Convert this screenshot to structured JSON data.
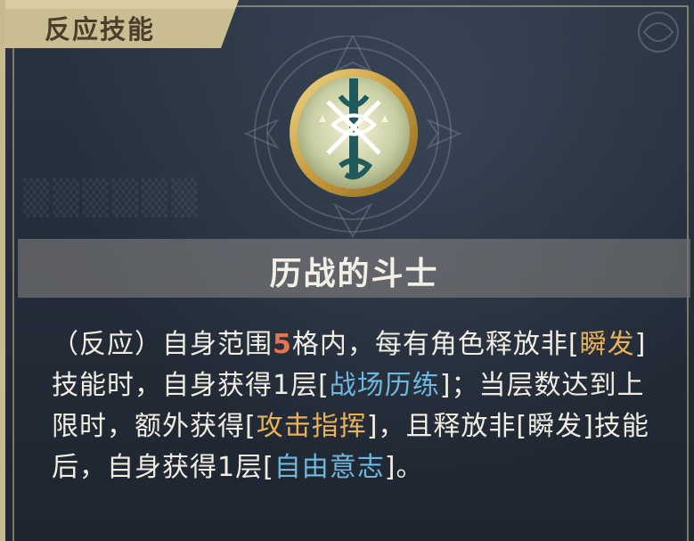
{
  "header": {
    "title": "反应技能"
  },
  "skill": {
    "name": "历战的斗士",
    "description": [
      {
        "t": "（反应）自身范围",
        "s": "plain"
      },
      {
        "t": "5",
        "s": "num"
      },
      {
        "t": "格内，每有角色释放非[",
        "s": "plain"
      },
      {
        "t": "瞬发",
        "s": "gold"
      },
      {
        "t": "]技能时，自身获得1层[",
        "s": "plain"
      },
      {
        "t": "战场历练",
        "s": "blue"
      },
      {
        "t": "]；当层数达到上限时，额外获得[",
        "s": "plain"
      },
      {
        "t": "攻击指挥",
        "s": "gold"
      },
      {
        "t": "]，且释放非[瞬发]技能后，自身获得1层[",
        "s": "plain"
      },
      {
        "t": "自由意志",
        "s": "blue"
      },
      {
        "t": "]。",
        "s": "plain"
      }
    ]
  },
  "icons": {
    "emblem": "crossed-swords-emblem-icon"
  },
  "colors": {
    "accent_gold": "#e8b15a",
    "accent_blue": "#6fb7de",
    "number_orange": "#e8734f",
    "frame_gold": "#c9b98e"
  }
}
